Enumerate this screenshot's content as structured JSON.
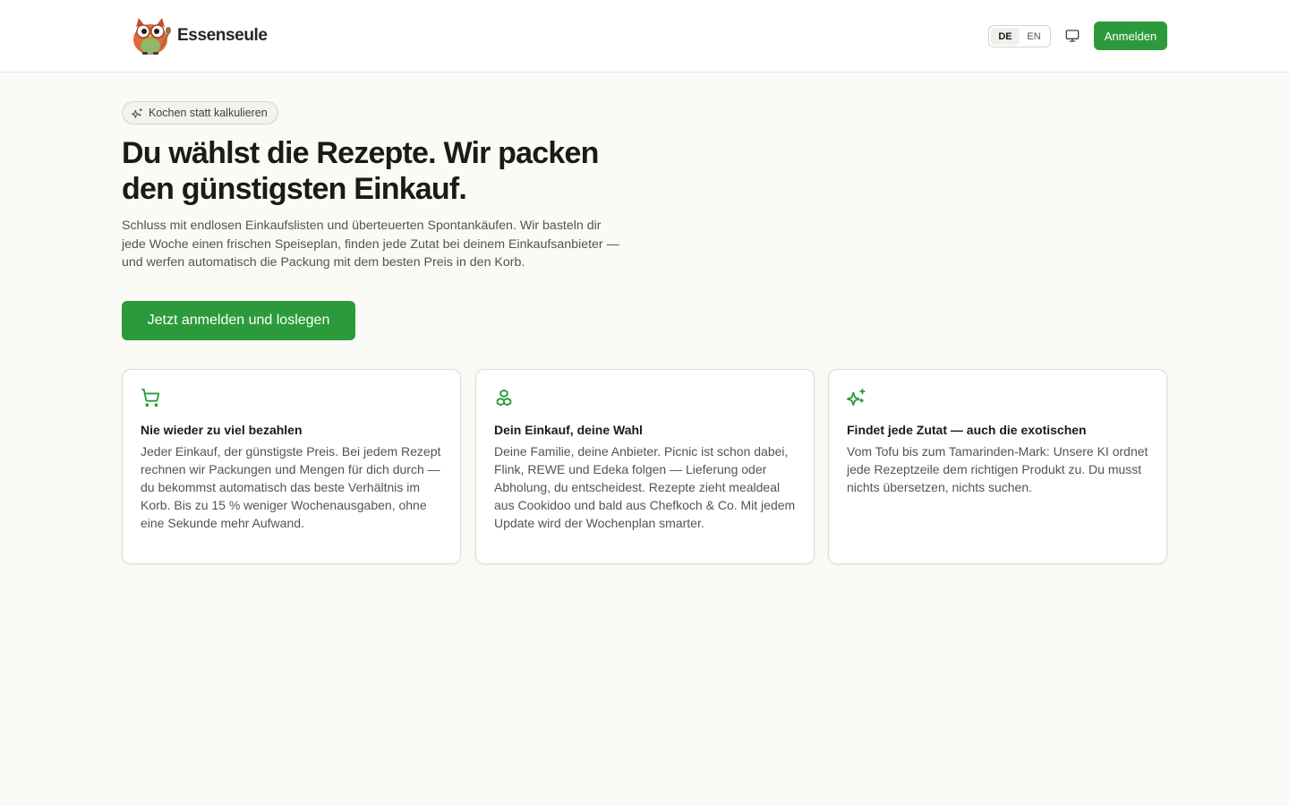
{
  "header": {
    "brand_name": "Essenseule",
    "languages": [
      {
        "code": "DE",
        "active": true
      },
      {
        "code": "EN",
        "active": false
      }
    ],
    "login_label": "Anmelden"
  },
  "hero": {
    "tagline": "Kochen statt kalkulieren",
    "title": "Du wählst die Rezepte. Wir packen den günstigsten Einkauf.",
    "text": "Schluss mit endlosen Einkaufslisten und überteuerten Spontankäufen. Wir basteln dir jede Woche einen frischen Speiseplan, finden jede Zutat bei deinem Einkaufsanbieter — und werfen automatisch die Packung mit dem besten Preis in den Korb.",
    "cta_label": "Jetzt anmelden und loslegen"
  },
  "features": [
    {
      "icon": "shopping-cart-icon",
      "title": "Nie wieder zu viel bezahlen",
      "text": "Jeder Einkauf, der günstigste Preis. Bei jedem Rezept rechnen wir Packungen und Mengen für dich durch — du bekommst automatisch das beste Verhältnis im Korb. Bis zu 15 % weniger Wochenausgaben, ohne eine Sekunde mehr Aufwand."
    },
    {
      "icon": "boxes-icon",
      "title": "Dein Einkauf, deine Wahl",
      "text": "Deine Familie, deine Anbieter. Picnic ist schon dabei, Flink, REWE und Edeka folgen — Lieferung oder Abholung, du entscheidest. Rezepte zieht mealdeal aus Cookidoo und bald aus Chefkoch & Co. Mit jedem Update wird der Wochenplan smarter."
    },
    {
      "icon": "sparkles-icon",
      "title": "Findet jede Zutat — auch die exotischen",
      "text": "Vom Tofu bis zum Tamarinden-Mark: Unsere KI ordnet jede Rezeptzeile dem richtigen Produkt zu. Du musst nichts übersetzen, nichts suchen."
    }
  ],
  "colors": {
    "accent": "#2c9a3a",
    "background": "#fafaf7"
  }
}
